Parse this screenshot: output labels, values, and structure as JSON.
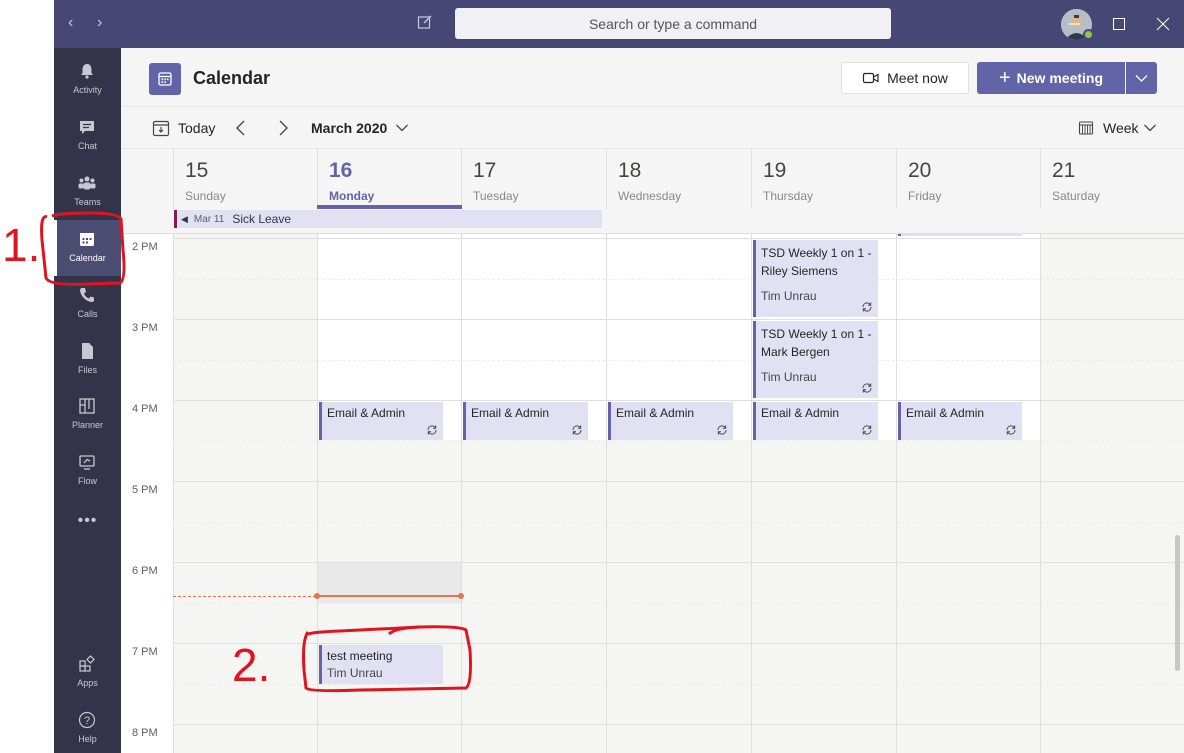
{
  "titlebar": {
    "search_placeholder": "Search or type a command",
    "back_icon": "chevron-left-icon",
    "forward_icon": "chevron-right-icon"
  },
  "rail": {
    "items": [
      {
        "label": "Activity",
        "icon": "bell-icon"
      },
      {
        "label": "Chat",
        "icon": "chat-icon"
      },
      {
        "label": "Teams",
        "icon": "teams-icon"
      },
      {
        "label": "Calendar",
        "icon": "calendar-icon",
        "active": true
      },
      {
        "label": "Calls",
        "icon": "phone-icon"
      },
      {
        "label": "Files",
        "icon": "file-icon"
      },
      {
        "label": "Planner",
        "icon": "planner-icon"
      },
      {
        "label": "Flow",
        "icon": "flow-icon"
      },
      {
        "label": "Apps",
        "icon": "apps-icon"
      },
      {
        "label": "Help",
        "icon": "help-icon"
      }
    ]
  },
  "header": {
    "title": "Calendar",
    "meet_now": "Meet now",
    "new_meeting": "New meeting"
  },
  "toolbar": {
    "today": "Today",
    "month": "March 2020",
    "view": "Week"
  },
  "days": [
    {
      "num": "15",
      "name": "Sunday"
    },
    {
      "num": "16",
      "name": "Monday",
      "today": true
    },
    {
      "num": "17",
      "name": "Tuesday"
    },
    {
      "num": "18",
      "name": "Wednesday"
    },
    {
      "num": "19",
      "name": "Thursday"
    },
    {
      "num": "20",
      "name": "Friday"
    },
    {
      "num": "21",
      "name": "Saturday"
    }
  ],
  "allday": {
    "date": "Mar 11",
    "title": "Sick Leave"
  },
  "times": [
    "2 PM",
    "3 PM",
    "4 PM",
    "5 PM",
    "6 PM",
    "7 PM",
    "8 PM"
  ],
  "events": {
    "thu_weekly_1": {
      "title": "TSD Weekly 1 on 1 - Riley Siemens",
      "organizer": "Tim Unrau"
    },
    "thu_weekly_2": {
      "title": "TSD Weekly 1 on 1 - Mark Bergen",
      "organizer": "Tim Unrau"
    },
    "email_admin": "Email & Admin",
    "test_meeting": {
      "title": "test meeting",
      "organizer": "Tim Unrau"
    }
  },
  "annotations": {
    "one": "1.",
    "two": "2."
  },
  "colors": {
    "titlebar": "#464775",
    "rail": "#33344a",
    "accent": "#6264a7",
    "event_bg": "#e1e1f3",
    "now_line": "#e97548",
    "annotation": "#e0141f"
  }
}
